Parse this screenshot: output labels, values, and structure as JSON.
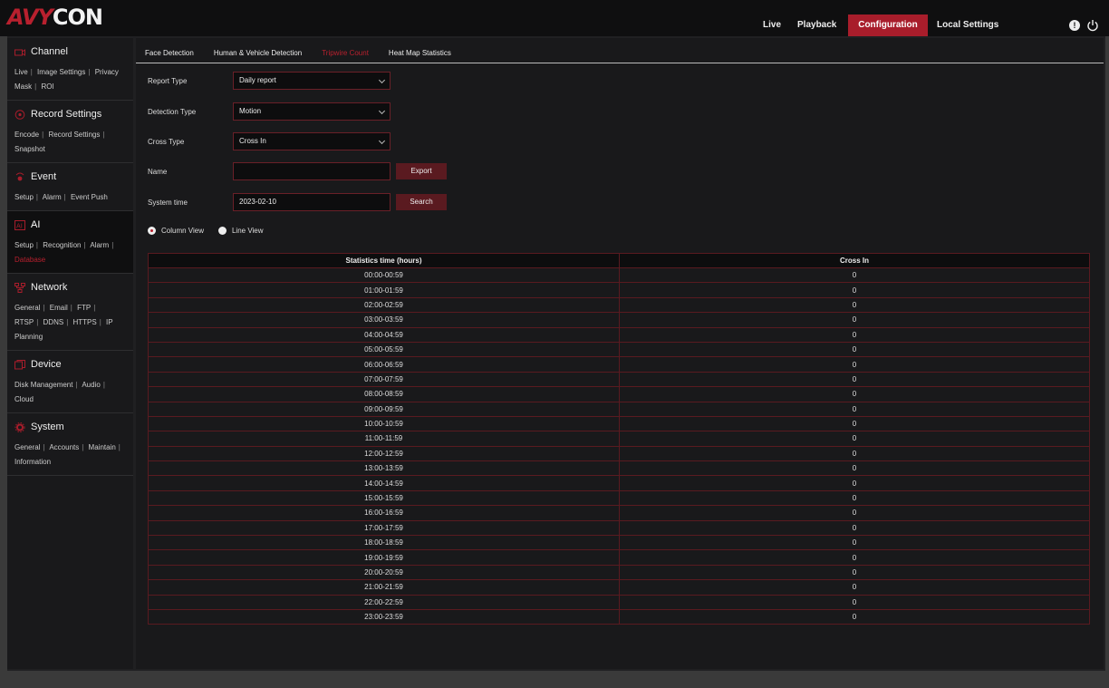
{
  "brand": {
    "logo_part1": "AVY",
    "logo_part2": "CON"
  },
  "topnav": {
    "live": "Live",
    "playback": "Playback",
    "configuration": "Configuration",
    "local_settings": "Local Settings"
  },
  "sidebar": [
    {
      "title": "Channel",
      "icon": "channel-icon",
      "links": [
        "Live",
        "Image Settings",
        "Privacy Mask",
        "ROI"
      ]
    },
    {
      "title": "Record Settings",
      "icon": "record-icon",
      "links": [
        "Encode",
        "Record Settings",
        "Snapshot"
      ]
    },
    {
      "title": "Event",
      "icon": "event-icon",
      "links": [
        "Setup",
        "Alarm",
        "Event Push"
      ]
    },
    {
      "title": "AI",
      "icon": "ai-icon",
      "links": [
        "Setup",
        "Recognition",
        "Alarm",
        "Database"
      ],
      "active": true,
      "active_link": "Database"
    },
    {
      "title": "Network",
      "icon": "network-icon",
      "links": [
        "General",
        "Email",
        "FTP",
        "RTSP",
        "DDNS",
        "HTTPS",
        "IP Planning"
      ]
    },
    {
      "title": "Device",
      "icon": "device-icon",
      "links": [
        "Disk Management",
        "Audio",
        "Cloud"
      ]
    },
    {
      "title": "System",
      "icon": "system-icon",
      "links": [
        "General",
        "Accounts",
        "Maintain",
        "Information"
      ]
    }
  ],
  "tabs": [
    "Face Detection",
    "Human & Vehicle Detection",
    "Tripwire Count",
    "Heat Map Statistics"
  ],
  "active_tab": "Tripwire Count",
  "form": {
    "report_type_label": "Report Type",
    "report_type_value": "Daily report",
    "detection_type_label": "Detection Type",
    "detection_type_value": "Motion",
    "cross_type_label": "Cross Type",
    "cross_type_value": "Cross In",
    "name_label": "Name",
    "name_value": "",
    "export_label": "Export",
    "system_time_label": "System time",
    "system_time_value": "2023-02-10",
    "search_label": "Search"
  },
  "view": {
    "column_label": "Column View",
    "line_label": "Line View",
    "selected": "Column View"
  },
  "table": {
    "headers": [
      "Statistics time (hours)",
      "Cross In"
    ],
    "rows": [
      [
        "00:00-00:59",
        "0"
      ],
      [
        "01:00-01:59",
        "0"
      ],
      [
        "02:00-02:59",
        "0"
      ],
      [
        "03:00-03:59",
        "0"
      ],
      [
        "04:00-04:59",
        "0"
      ],
      [
        "05:00-05:59",
        "0"
      ],
      [
        "06:00-06:59",
        "0"
      ],
      [
        "07:00-07:59",
        "0"
      ],
      [
        "08:00-08:59",
        "0"
      ],
      [
        "09:00-09:59",
        "0"
      ],
      [
        "10:00-10:59",
        "0"
      ],
      [
        "11:00-11:59",
        "0"
      ],
      [
        "12:00-12:59",
        "0"
      ],
      [
        "13:00-13:59",
        "0"
      ],
      [
        "14:00-14:59",
        "0"
      ],
      [
        "15:00-15:59",
        "0"
      ],
      [
        "16:00-16:59",
        "0"
      ],
      [
        "17:00-17:59",
        "0"
      ],
      [
        "18:00-18:59",
        "0"
      ],
      [
        "19:00-19:59",
        "0"
      ],
      [
        "20:00-20:59",
        "0"
      ],
      [
        "21:00-21:59",
        "0"
      ],
      [
        "22:00-22:59",
        "0"
      ],
      [
        "23:00-23:59",
        "0"
      ]
    ]
  },
  "colors": {
    "accent": "#a81d2b",
    "background": "#19191b",
    "border": "#5a1a20"
  }
}
